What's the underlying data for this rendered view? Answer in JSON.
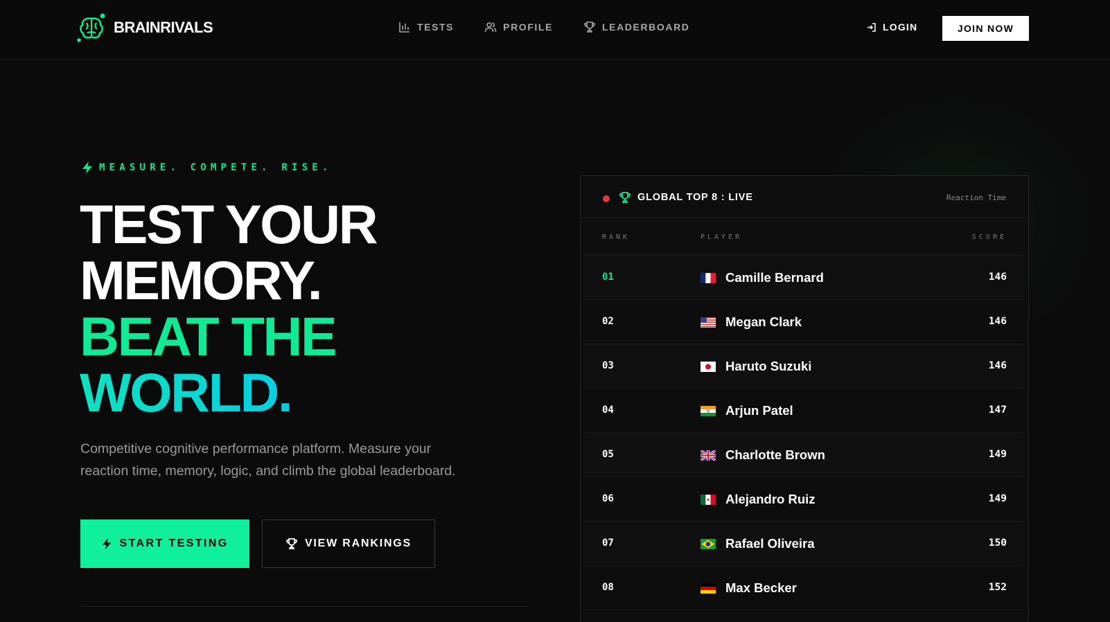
{
  "brand": {
    "name": "BRAINRIVALS",
    "logo_icon": "brain-icon"
  },
  "nav": {
    "links": [
      {
        "label": "TESTS",
        "icon": "bar-chart-icon"
      },
      {
        "label": "PROFILE",
        "icon": "users-icon"
      },
      {
        "label": "LEADERBOARD",
        "icon": "trophy-icon"
      }
    ],
    "login_label": "LOGIN",
    "join_label": "JOIN NOW"
  },
  "hero": {
    "tagline": "MEASURE. COMPETE. RISE.",
    "headline": [
      "TEST YOUR",
      "MEMORY.",
      "BEAT THE",
      "WORLD."
    ],
    "description": "Competitive cognitive performance platform. Measure your reaction time, memory, logic, and climb the global leaderboard.",
    "start_label": "START TESTING",
    "rankings_label": "VIEW RANKINGS"
  },
  "leaderboard": {
    "title": "GLOBAL TOP 8 : LIVE",
    "metric": "Reaction Time",
    "columns": {
      "rank": "RANK",
      "player": "PLAYER",
      "score": "SCORE"
    },
    "rows": [
      {
        "rank": "01",
        "name": "Camille Bernard",
        "country": "fr",
        "score": "146"
      },
      {
        "rank": "02",
        "name": "Megan Clark",
        "country": "us",
        "score": "146"
      },
      {
        "rank": "03",
        "name": "Haruto Suzuki",
        "country": "jp",
        "score": "146"
      },
      {
        "rank": "04",
        "name": "Arjun Patel",
        "country": "in",
        "score": "147"
      },
      {
        "rank": "05",
        "name": "Charlotte Brown",
        "country": "gb",
        "score": "149"
      },
      {
        "rank": "06",
        "name": "Alejandro Ruiz",
        "country": "mx",
        "score": "149"
      },
      {
        "rank": "07",
        "name": "Rafael Oliveira",
        "country": "br",
        "score": "150"
      },
      {
        "rank": "08",
        "name": "Max Becker",
        "country": "de",
        "score": "152"
      }
    ]
  },
  "colors": {
    "accent": "#10e890",
    "cyan": "#07d2ea",
    "live": "#e23a3a",
    "background": "#0b0b0b"
  }
}
